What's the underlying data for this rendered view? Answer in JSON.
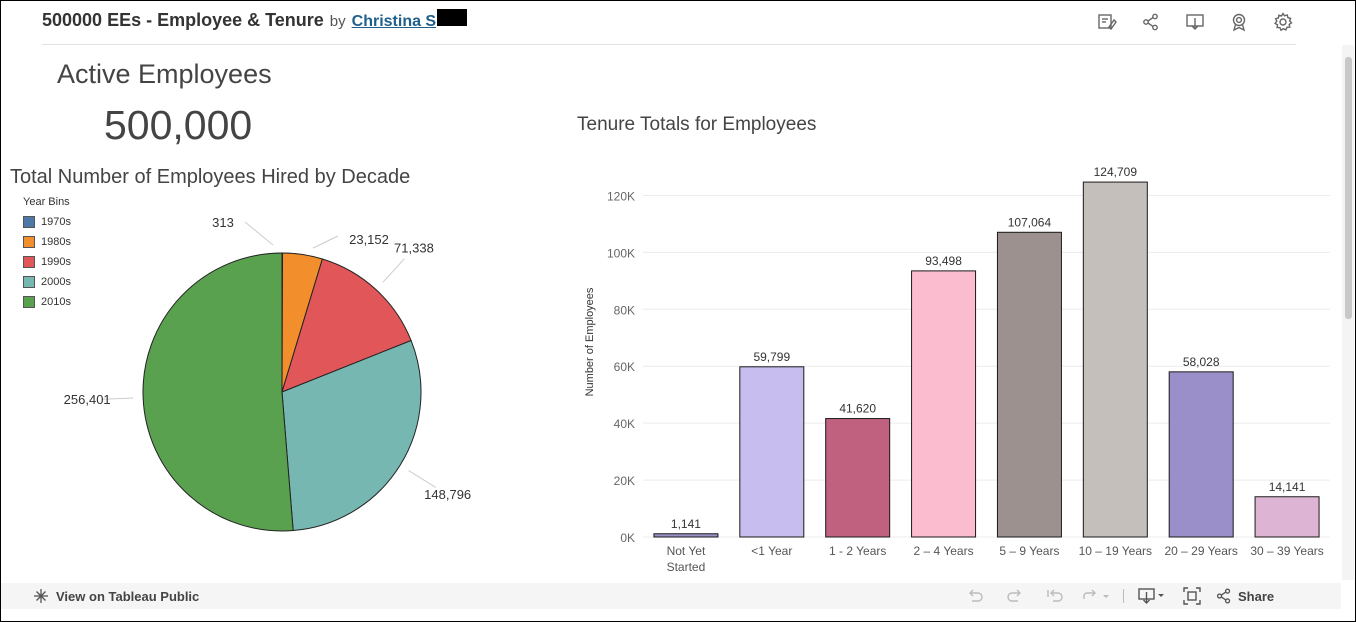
{
  "header": {
    "title": "500000 EEs - Employee & Tenure",
    "by": "by",
    "author": "Christina S"
  },
  "kpi": {
    "label": "Active Employees",
    "value": "500,000"
  },
  "icons": [
    "annotate-icon",
    "share-network-icon",
    "download-icon",
    "award-icon",
    "settings-gear-icon"
  ],
  "chart_data": [
    {
      "type": "pie",
      "title": "Total Number of Employees Hired by Decade",
      "legend_title": "Year Bins",
      "legend_position": "top-left",
      "categories": [
        "1970s",
        "1980s",
        "1990s",
        "2000s",
        "2010s"
      ],
      "values": [
        313,
        23152,
        71338,
        148796,
        256401
      ],
      "labels": [
        "313",
        "23,152",
        "71,338",
        "148,796",
        "256,401"
      ],
      "colors": [
        "#4e79a7",
        "#f28e2b",
        "#e15759",
        "#76b7b2",
        "#59a14f"
      ]
    },
    {
      "type": "bar",
      "title": "Tenure Totals for Employees",
      "xlabel": "",
      "ylabel": "Number of Employees",
      "ylim": [
        0,
        130000
      ],
      "yticks": [
        0,
        20000,
        40000,
        60000,
        80000,
        100000,
        120000
      ],
      "ytick_labels": [
        "0K",
        "20K",
        "40K",
        "60K",
        "80K",
        "100K",
        "120K"
      ],
      "grid": true,
      "categories": [
        "Not Yet\nStarted",
        "<1 Year",
        "1 - 2 Years",
        "2 – 4 Years",
        "5 – 9 Years",
        "10 – 19 Years",
        "20 – 29 Years",
        "30 – 39 Years"
      ],
      "values": [
        1141,
        59799,
        41620,
        93498,
        107064,
        124709,
        58028,
        14141
      ],
      "labels": [
        "1,141",
        "59,799",
        "41,620",
        "93,498",
        "107,064",
        "124,709",
        "58,028",
        "14,141"
      ],
      "colors": [
        "#9c90c8",
        "#c7bdee",
        "#c0617f",
        "#fbbcd0",
        "#9c918e",
        "#c5bfbc",
        "#9a8fc9",
        "#deb4d4"
      ]
    }
  ],
  "footer": {
    "view_label": "View on Tableau Public",
    "share_label": "Share"
  }
}
